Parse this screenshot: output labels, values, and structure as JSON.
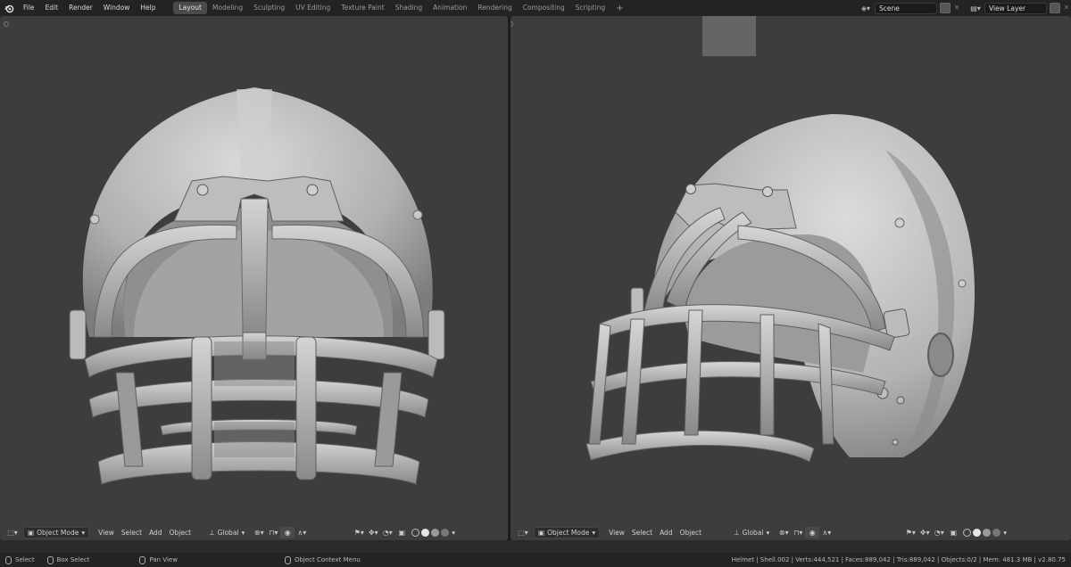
{
  "app": {
    "menu": [
      "File",
      "Edit",
      "Render",
      "Window",
      "Help"
    ],
    "workspaces": [
      {
        "label": "Layout",
        "active": true
      },
      {
        "label": "Modeling",
        "active": false
      },
      {
        "label": "Sculpting",
        "active": false
      },
      {
        "label": "UV Editing",
        "active": false
      },
      {
        "label": "Texture Paint",
        "active": false
      },
      {
        "label": "Shading",
        "active": false
      },
      {
        "label": "Animation",
        "active": false
      },
      {
        "label": "Rendering",
        "active": false
      },
      {
        "label": "Compositing",
        "active": false
      },
      {
        "label": "Scripting",
        "active": false
      }
    ],
    "add_workspace": "+",
    "scene_label": "Scene",
    "view_layer_label": "View Layer"
  },
  "viewport_header": {
    "mode": "Object Mode",
    "menus": [
      "View",
      "Select",
      "Add",
      "Object"
    ],
    "transform": "Global"
  },
  "statusbar": {
    "select": "Select",
    "box_select": "Box Select",
    "pan_view": "Pan View",
    "context_menu": "Object Context Menu",
    "stats": "Helmet | Shell.002 | Verts:444,521 | Faces:889,042 | Tris:889,042 | Objects:0/2 | Mem: 481.3 MB | v2.80.75"
  },
  "colors": {
    "viewport_bg": "#3d3d3d",
    "topbar_bg": "#232323",
    "model_light": "#d7d7d7",
    "model_mid": "#a9a9a9",
    "model_dark": "#6e6e6e",
    "active_tab": "#4a4a4a"
  },
  "icons": [
    "blender-logo-icon",
    "scene-icon",
    "view-layer-icon",
    "editor-type-icon",
    "object-mode-icon",
    "orientation-icon",
    "snap-icon",
    "proportional-icon",
    "visibility-icon",
    "gizmo-icon",
    "overlay-icon",
    "xray-icon",
    "solid-shading-icon",
    "material-shading-icon",
    "rendered-shading-icon",
    "wireframe-shading-icon"
  ]
}
